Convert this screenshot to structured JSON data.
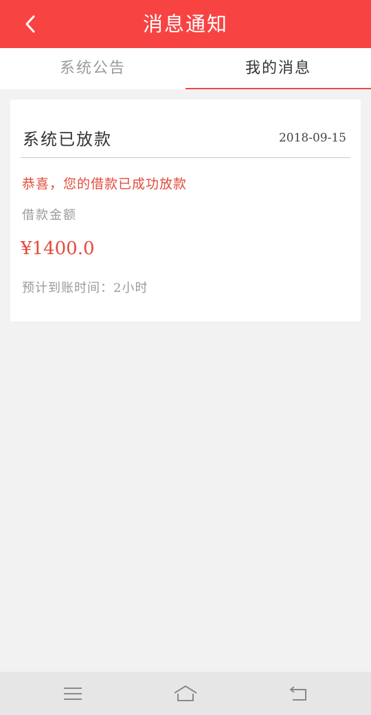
{
  "header": {
    "title": "消息通知",
    "background_color": "#f84343",
    "back_icon": "chevron-left-icon"
  },
  "tabs": [
    {
      "label": "系统公告",
      "active": false
    },
    {
      "label": "我的消息",
      "active": true
    }
  ],
  "message": {
    "title": "系统已放款",
    "date": "2018-09-15",
    "congrats_text": "恭喜，您的借款已成功放款",
    "amount_label": "借款金额",
    "amount_value": "¥1400.0",
    "arrival_text": "预计到账时间：2小时"
  },
  "navbar": {
    "menu_icon": "menu-icon",
    "home_icon": "home-icon",
    "back_icon": "back-icon"
  }
}
